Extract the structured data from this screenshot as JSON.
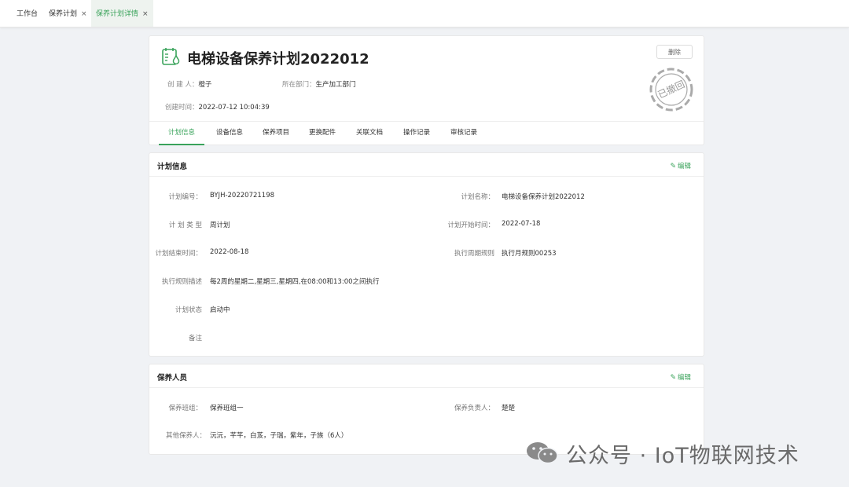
{
  "tabs": [
    {
      "label": "工作台"
    },
    {
      "label": "保养计划",
      "close": "×"
    },
    {
      "label": "保养计划详情",
      "close": "×"
    }
  ],
  "header": {
    "title": "电梯设备保养计划2022012",
    "creator_label": "创 建 人：",
    "creator": "橙子",
    "dept_label": "所在部门：",
    "dept": "生产加工部门",
    "created_label": "创建时间：",
    "created": "2022-07-12 10:04:39",
    "delete_label": "删除",
    "stamp_text": "已撤回"
  },
  "detail_tabs": [
    "计划信息",
    "设备信息",
    "保养项目",
    "更换配件",
    "关联文档",
    "操作记录",
    "审核记录"
  ],
  "plan_info": {
    "title": "计划信息",
    "edit_label": "编辑",
    "fields": [
      {
        "label": "计划编号：",
        "value": "BYJH-20220721198"
      },
      {
        "label": "计划名称：",
        "value": "电梯设备保养计划2022012"
      },
      {
        "label": "计 划 类 型",
        "value": "周计划"
      },
      {
        "label": "计划开始时间：",
        "value": "2022-07-18"
      },
      {
        "label": "计划结束时间：",
        "value": "2022-08-18"
      },
      {
        "label": "执行周期规则",
        "value": "执行月规则00253"
      },
      {
        "label": "执行规则描述",
        "value": "每2周的星期二,星期三,星期四,在08:00和13:00之间执行"
      },
      {
        "label": "计划状态",
        "value": "启动中"
      },
      {
        "label": "备注",
        "value": ""
      }
    ]
  },
  "staff": {
    "title": "保养人员",
    "edit_label": "编辑",
    "fields": [
      {
        "label": "保养班组：",
        "value": "保养班组一"
      },
      {
        "label": "保养负责人：",
        "value": "楚楚"
      },
      {
        "label": "其他保养人：",
        "value": "沅沅，芊芊，白芨，子瑞，紫年，子族（6人）"
      }
    ]
  },
  "watermark": {
    "text": "公众号 · IoT物联网技术"
  },
  "colors": {
    "accent": "#3aa35b",
    "background": "#f0f2f5"
  }
}
